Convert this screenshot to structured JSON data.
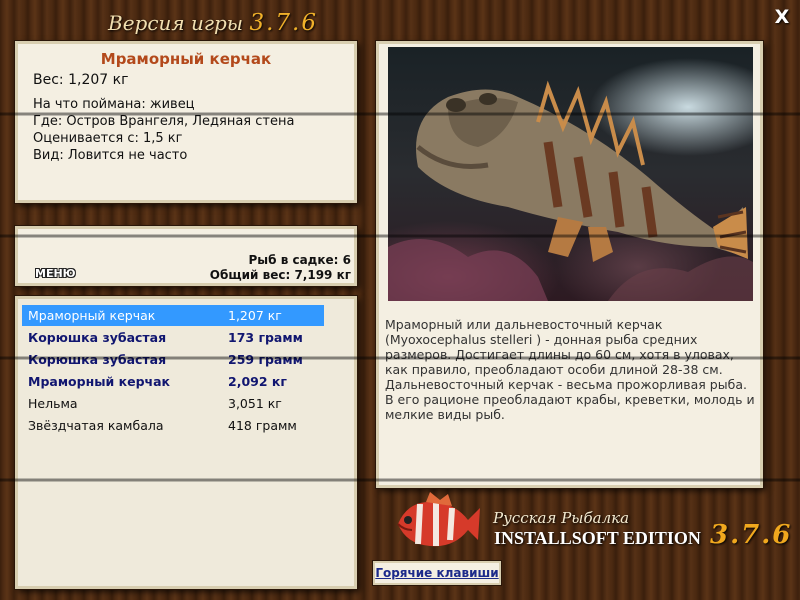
{
  "header": {
    "title_text": "Версия игры",
    "version": "3.7.6",
    "close_label": "X"
  },
  "info": {
    "fish_name": "Мраморный керчак",
    "weight": "Вес: 1,207 кг",
    "bait": "На что поймана: живец",
    "location": "Где: Остров Врангеля, Ледяная стена",
    "value": "Оценивается с: 1,5 кг",
    "frequency": "Вид: Ловится не часто"
  },
  "cage": {
    "menu_label": "МЕНЮ",
    "count": "Рыб в садке: 6",
    "total_weight": "Общий вес: 7,199 кг"
  },
  "catch_list": [
    {
      "name": "Мраморный керчак",
      "weight": "1,207 кг",
      "selected": true,
      "bold": false
    },
    {
      "name": "Корюшка зубастая",
      "weight": "173 грамм",
      "selected": false,
      "bold": true
    },
    {
      "name": "Корюшка зубастая",
      "weight": "259 грамм",
      "selected": false,
      "bold": true
    },
    {
      "name": "Мраморный керчак",
      "weight": "2,092 кг",
      "selected": false,
      "bold": true
    },
    {
      "name": "Нельма",
      "weight": "3,051 кг",
      "selected": false,
      "bold": false
    },
    {
      "name": "Звёздчатая камбала",
      "weight": "418 грамм",
      "selected": false,
      "bold": false
    }
  ],
  "description": "Мраморный или дальневосточный керчак (Myoxocephalus stelleri ) - донная рыба средних размеров. Достигает длины до 60 см, хотя в уловах, как правило, преобладают особи длиной 28-38 см. Дальневосточный керчак - весьма прожорливая рыба. В его рационе преобладают крабы, креветки, молодь и мелкие виды рыб.",
  "brand": {
    "line1": "Русская Рыбалка",
    "line2": "INSTALLSOFT EDITION",
    "version": "3.7.6"
  },
  "hotkeys_label": "Горячие клавиши",
  "colors": {
    "accent": "#f0b12a",
    "fish_title": "#b3491b",
    "selection": "#3399ff",
    "bold_row": "#111670"
  }
}
